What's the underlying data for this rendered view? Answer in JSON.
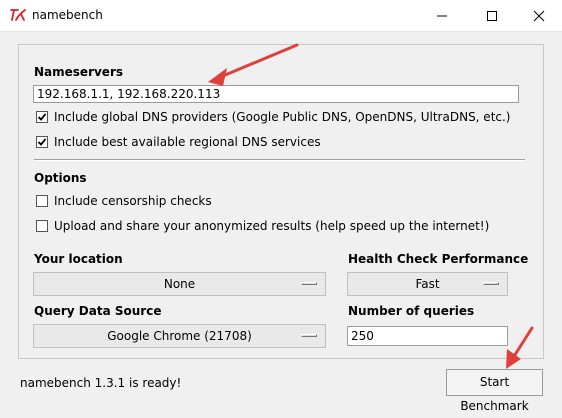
{
  "window": {
    "title": "namebench"
  },
  "nameservers": {
    "heading": "Nameservers",
    "value": "192.168.1.1, 192.168.220.113",
    "include_global_label": "Include global DNS providers (Google Public DNS, OpenDNS, UltraDNS, etc.)",
    "include_global_checked": true,
    "include_regional_label": "Include best available regional DNS services",
    "include_regional_checked": true
  },
  "options": {
    "heading": "Options",
    "censorship_label": "Include censorship checks",
    "censorship_checked": false,
    "upload_label": "Upload and share your anonymized results (help speed up the internet!)",
    "upload_checked": false
  },
  "location": {
    "label": "Your location",
    "selected": "None"
  },
  "health_check": {
    "label": "Health Check Performance",
    "selected": "Fast"
  },
  "query_source": {
    "label": "Query Data Source",
    "selected": "Google Chrome (21708)"
  },
  "num_queries": {
    "label": "Number of queries",
    "value": "250"
  },
  "status": {
    "text": "namebench 1.3.1 is ready!"
  },
  "start_button": {
    "label": "Start Benchmark"
  },
  "colors": {
    "arrow": "#e0403a"
  }
}
